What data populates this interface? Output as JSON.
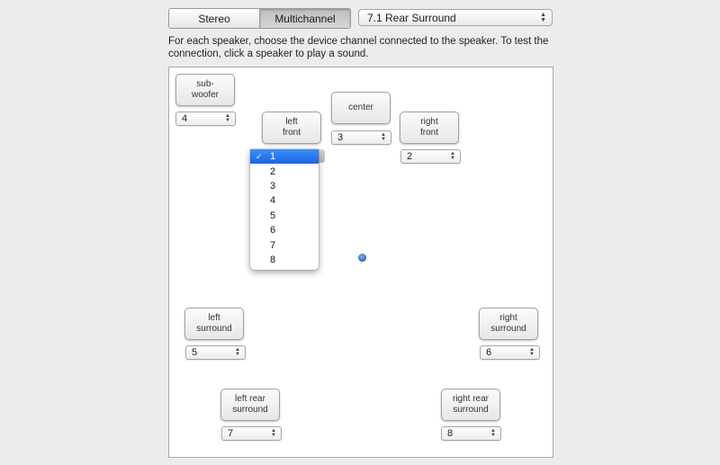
{
  "mode_tabs": [
    {
      "label": "Stereo",
      "selected": false
    },
    {
      "label": "Multichannel",
      "selected": true
    }
  ],
  "configuration": {
    "value": "7.1 Rear Surround"
  },
  "instructions": "For each speaker, choose the device channel connected to the speaker. To test the connection, click a speaker to play a sound.",
  "speakers": {
    "subwoofer": {
      "label": "sub-\nwoofer",
      "channel": "4"
    },
    "left_front": {
      "label": "left\nfront",
      "channel": "1"
    },
    "center": {
      "label": "center",
      "channel": "3"
    },
    "right_front": {
      "label": "right\nfront",
      "channel": "2"
    },
    "left_surround": {
      "label": "left\nsurround",
      "channel": "5"
    },
    "right_surround": {
      "label": "right\nsurround",
      "channel": "6"
    },
    "left_rear_surround": {
      "label": "left rear\nsurround",
      "channel": "7"
    },
    "right_rear_surround": {
      "label": "right rear\nsurround",
      "channel": "8"
    }
  },
  "channel_menu": {
    "open_for": "left front",
    "selected": "1",
    "checkmark": "✓",
    "options": [
      "1",
      "2",
      "3",
      "4",
      "5",
      "6",
      "7",
      "8"
    ]
  },
  "colors": {
    "menu_highlight": "#2a74ee",
    "listener": "#2a5fb0"
  }
}
